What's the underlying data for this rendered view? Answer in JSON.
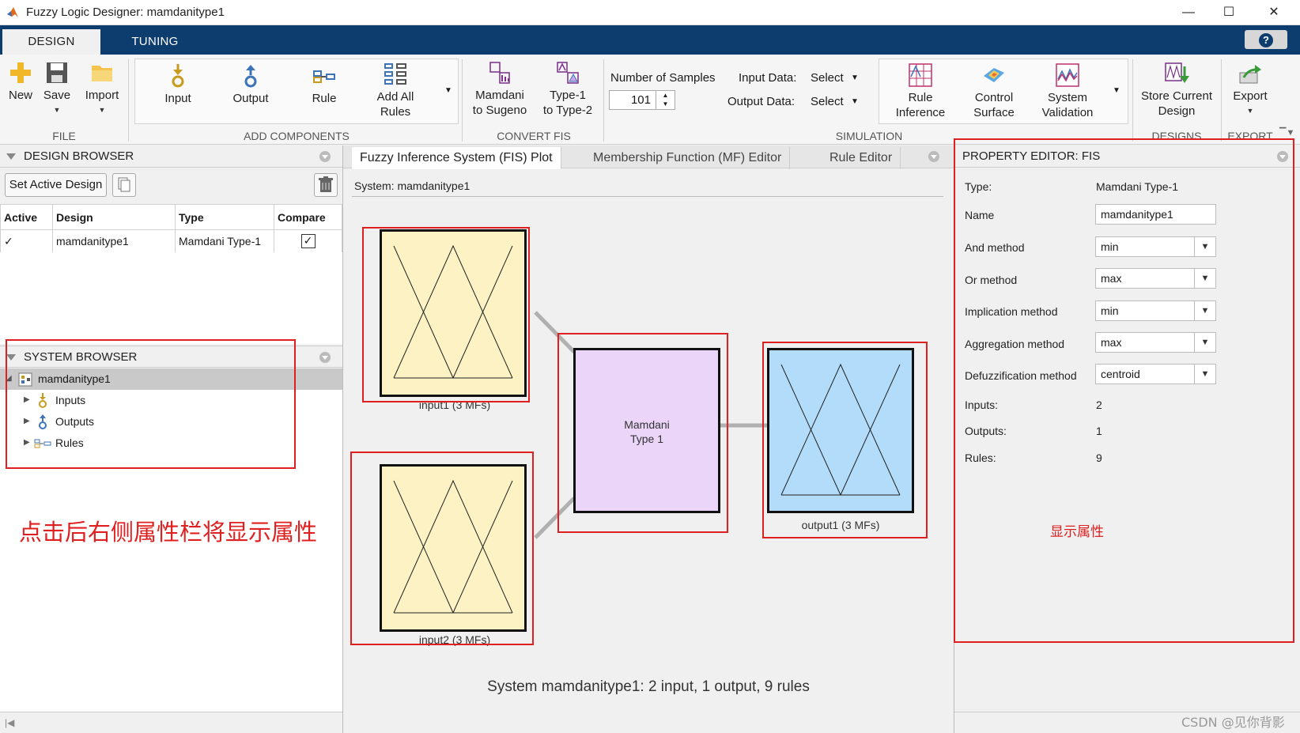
{
  "window": {
    "title": "Fuzzy Logic Designer: mamdanitype1",
    "minimize": "—",
    "maximize": "☐",
    "close": "✕"
  },
  "tabs": {
    "design": "DESIGN",
    "tuning": "TUNING",
    "help": "?"
  },
  "ribbon": {
    "file": {
      "label": "FILE",
      "new": "New",
      "save": "Save",
      "import": "Import"
    },
    "add_components": {
      "label": "ADD COMPONENTS",
      "input": "Input",
      "output": "Output",
      "rule": "Rule",
      "add_all_rules": [
        "Add All",
        "Rules"
      ]
    },
    "convert_fis": {
      "label": "CONVERT FIS",
      "mamdani_to_sugeno": [
        "Mamdani",
        "to Sugeno"
      ],
      "type1_to_type2": [
        "Type-1",
        "to Type-2"
      ]
    },
    "simulation": {
      "label": "SIMULATION",
      "number_of_samples_label": "Number of Samples",
      "number_of_samples_value": "101",
      "input_data_label": "Input Data:",
      "input_data_value": "Select",
      "output_data_label": "Output Data:",
      "output_data_value": "Select",
      "rule_inference": [
        "Rule",
        "Inference"
      ],
      "control_surface": [
        "Control",
        "Surface"
      ],
      "system_validation": [
        "System",
        "Validation"
      ]
    },
    "designs": {
      "label": "DESIGNS",
      "store_current_design": [
        "Store Current",
        "Design"
      ]
    },
    "export": {
      "label": "EXPORT",
      "export": "Export"
    }
  },
  "design_browser": {
    "title": "DESIGN BROWSER",
    "set_active_button": "Set Active Design",
    "columns": [
      "Active",
      "Design",
      "Type",
      "Compare"
    ],
    "rows": [
      {
        "active": "✓",
        "design": "mamdanitype1",
        "type": "Mamdani Type-1",
        "compare": "✓"
      }
    ]
  },
  "system_browser": {
    "title": "SYSTEM BROWSER",
    "root": "mamdanitype1",
    "children": [
      "Inputs",
      "Outputs",
      "Rules"
    ]
  },
  "annotation_left": "点击后右侧属性栏将显示属性",
  "annotation_right": "显示属性",
  "center": {
    "tabs": [
      "Fuzzy Inference System (FIS) Plot",
      "Membership Function (MF) Editor",
      "Rule Editor"
    ],
    "system_label": "System: mamdanitype1",
    "input1_label": "input1 (3 MFs)",
    "input2_label": "input2 (3 MFs)",
    "output1_label": "output1 (3 MFs)",
    "engine_label": [
      "Mamdani",
      "Type 1"
    ],
    "summary": "System mamdanitype1: 2 input, 1 output, 9 rules",
    "colors": {
      "input": "#fcf2c4",
      "engine": "#ebd5f8",
      "output": "#b3dcfb"
    }
  },
  "property_editor": {
    "title": "PROPERTY EDITOR: FIS",
    "type_label": "Type:",
    "type_value": "Mamdani Type-1",
    "name_label": "Name",
    "name_value": "mamdanitype1",
    "and_label": "And method",
    "and_value": "min",
    "or_label": "Or method",
    "or_value": "max",
    "imp_label": "Implication method",
    "imp_value": "min",
    "agg_label": "Aggregation method",
    "agg_value": "max",
    "defuzz_label": "Defuzzification method",
    "defuzz_value": "centroid",
    "inputs_label": "Inputs:",
    "inputs_value": "2",
    "outputs_label": "Outputs:",
    "outputs_value": "1",
    "rules_label": "Rules:",
    "rules_value": "9"
  },
  "watermark": "CSDN @见你背影"
}
